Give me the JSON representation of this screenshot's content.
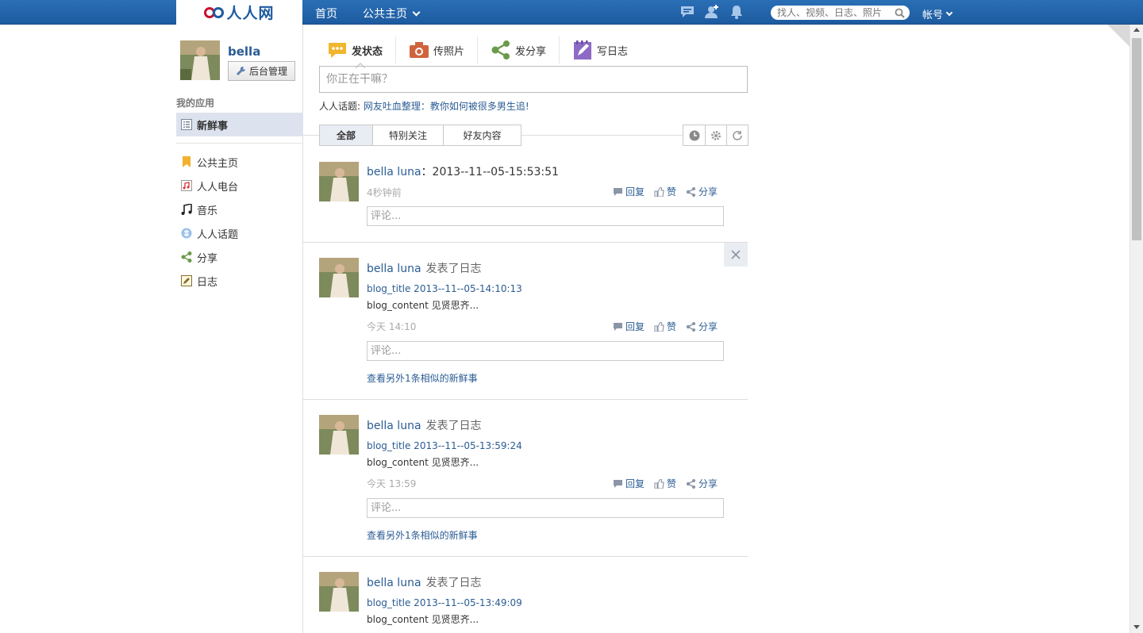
{
  "app": {
    "logo_text": "人人网",
    "brand_color": "#1d5b9f",
    "nav": {
      "home": "首页",
      "public_page": "公共主页"
    },
    "search_placeholder": "找人、视频、日志、照片",
    "account": "帐号"
  },
  "profile": {
    "name": "bella",
    "admin_button": "后台管理"
  },
  "sidebar": {
    "apps_title": "我的应用",
    "items": [
      {
        "label": "新鲜事",
        "icon": "news-feed-icon",
        "active": true
      },
      {
        "label": "公共主页",
        "icon": "bookmark-icon"
      },
      {
        "label": "人人电台",
        "icon": "radio-icon"
      },
      {
        "label": "音乐",
        "icon": "music-note-icon"
      },
      {
        "label": "人人话题",
        "icon": "topic-icon"
      },
      {
        "label": "分享",
        "icon": "share-icon"
      },
      {
        "label": "日志",
        "icon": "blog-icon"
      }
    ]
  },
  "publisher": {
    "tabs": [
      {
        "label": "发状态",
        "icon": "speech-bubble-icon"
      },
      {
        "label": "传照片",
        "icon": "camera-icon"
      },
      {
        "label": "发分享",
        "icon": "share-icon"
      },
      {
        "label": "写日志",
        "icon": "notebook-icon"
      }
    ],
    "input_placeholder": "你正在干嘛？",
    "topic_prefix": "人人话题:",
    "topic_link": "网友吐血整理：教你如何被很多男生追!"
  },
  "filters": {
    "tabs": [
      "全部",
      "特别关注",
      "好友内容"
    ]
  },
  "feed": {
    "ops": {
      "reply": "回复",
      "like": "赞",
      "share": "分享"
    },
    "comment_placeholder": "评论...",
    "items": [
      {
        "author": "bella luna",
        "text": "：2013--11--05-15:53:51",
        "time": "4秒钟前"
      },
      {
        "author": "bella luna",
        "action": "发表了日志",
        "blog_title": "blog_title 2013--11--05-14:10:13",
        "blog_content": "blog_content 见贤思齐...",
        "time": "今天 14:10",
        "similar": "查看另外1条相似的新鲜事"
      },
      {
        "author": "bella luna",
        "action": "发表了日志",
        "blog_title": "blog_title 2013--11--05-13:59:24",
        "blog_content": "blog_content 见贤思齐...",
        "time": "今天 13:59",
        "similar": "查看另外1条相似的新鲜事"
      },
      {
        "author": "bella luna",
        "action": "发表了日志",
        "blog_title": "blog_title 2013--11--05-13:49:09",
        "blog_content": "blog_content 见贤思齐..."
      }
    ]
  }
}
